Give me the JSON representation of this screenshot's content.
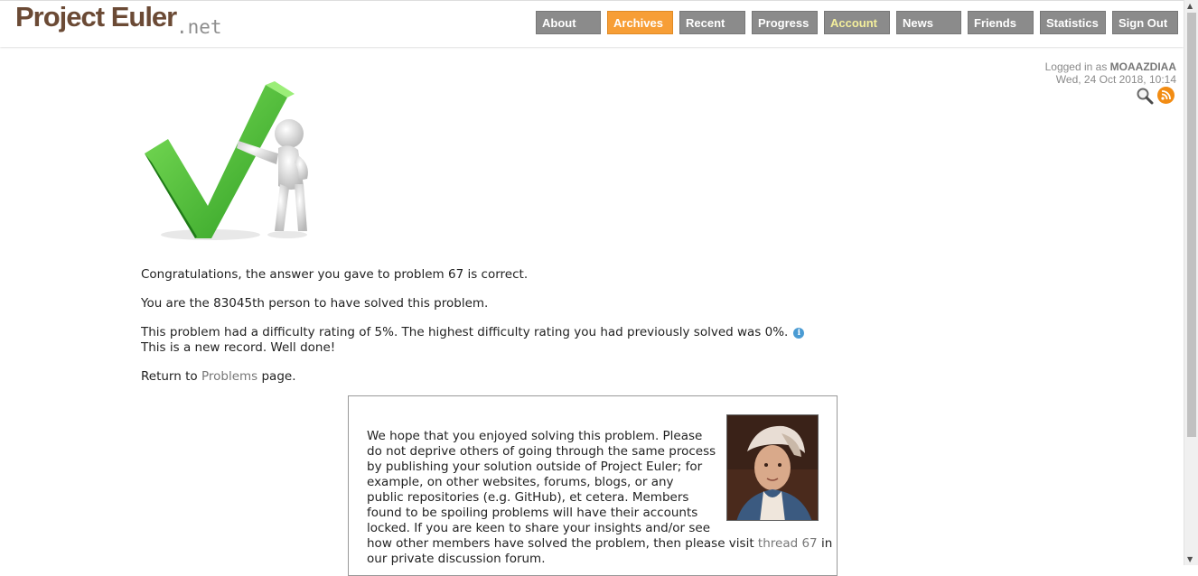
{
  "logo": {
    "main": "Project Euler",
    "suffix": ".net"
  },
  "nav": [
    {
      "label": "About",
      "state": "normal"
    },
    {
      "label": "Archives",
      "state": "active"
    },
    {
      "label": "Recent",
      "state": "normal"
    },
    {
      "label": "Progress",
      "state": "normal"
    },
    {
      "label": "Account",
      "state": "account"
    },
    {
      "label": "News",
      "state": "normal"
    },
    {
      "label": "Friends",
      "state": "normal"
    },
    {
      "label": "Statistics",
      "state": "normal"
    },
    {
      "label": "Sign Out",
      "state": "normal"
    }
  ],
  "login": {
    "prefix": "Logged in as",
    "username": "MOAAZDIAA",
    "datetime": "Wed, 24 Oct 2018, 10:14"
  },
  "message": {
    "congrats": "Congratulations, the answer you gave to problem 67 is correct.",
    "solver": "You are the 83045th person to have solved this problem.",
    "difficulty": "This problem had a difficulty rating of 5%. The highest difficulty rating you had previously solved was 0%.",
    "record": "This is a new record. Well done!",
    "return_prefix": "Return to",
    "return_link": "Problems",
    "return_suffix": "page."
  },
  "notice": {
    "lines": [
      "We hope that you enjoyed solving this problem. Please",
      "do not deprive others of going through the same process",
      "by publishing your solution outside of Project Euler; for",
      "example, on other websites, forums, blogs, or any",
      "public repositories (e.g. GitHub), et cetera. Members",
      "found to be spoiling problems will have their accounts",
      "locked. If you are keen to share your insights and/or see"
    ],
    "line8_prefix": "how other members have solved the problem, then please visit",
    "thread_link": "thread 67",
    "line8_suffix": "in",
    "line9": "our private discussion forum."
  },
  "colors": {
    "accent": "#f79e36",
    "nav_bg": "#8b8b8b",
    "logo": "#6b4a35",
    "link": "#777777"
  }
}
